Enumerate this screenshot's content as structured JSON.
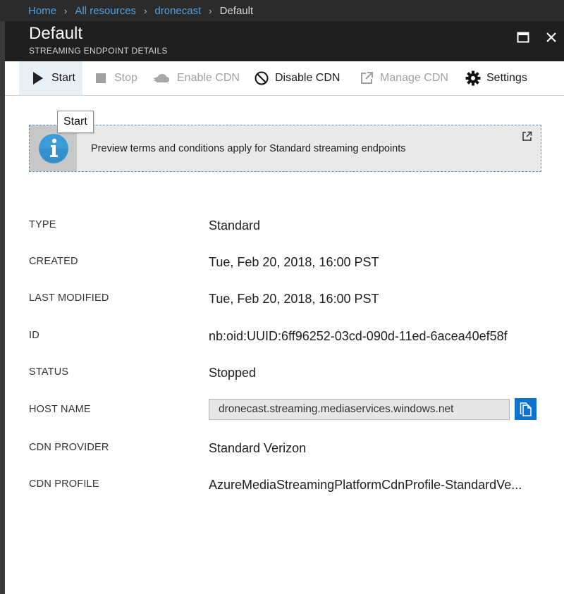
{
  "breadcrumb": {
    "items": [
      "Home",
      "All resources",
      "dronecast"
    ],
    "current": "Default",
    "separator": "›"
  },
  "header": {
    "title": "Default",
    "subtitle": "STREAMING ENDPOINT DETAILS"
  },
  "toolbar": {
    "start": "Start",
    "stop": "Stop",
    "enable_cdn": "Enable CDN",
    "disable_cdn": "Disable CDN",
    "manage_cdn": "Manage CDN",
    "settings": "Settings"
  },
  "tooltip": "Start",
  "info": {
    "text": "Preview terms and conditions apply for Standard streaming endpoints"
  },
  "props": {
    "type": {
      "label": "TYPE",
      "value": "Standard"
    },
    "created": {
      "label": "CREATED",
      "value": "Tue, Feb 20, 2018, 16:00 PST"
    },
    "modified": {
      "label": "LAST MODIFIED",
      "value": "Tue, Feb 20, 2018, 16:00 PST"
    },
    "id": {
      "label": "ID",
      "value": "nb:oid:UUID:6ff96252-03cd-090d-11ed-6acea40ef58f"
    },
    "status": {
      "label": "STATUS",
      "value": "Stopped"
    },
    "host": {
      "label": "HOST NAME",
      "value": "dronecast.streaming.mediaservices.windows.net"
    },
    "cdn_provider": {
      "label": "CDN PROVIDER",
      "value": "Standard Verizon"
    },
    "cdn_profile": {
      "label": "CDN PROFILE",
      "value": "AzureMediaStreamingPlatformCdnProfile-StandardVe..."
    }
  },
  "colors": {
    "accent": "#0f72cf",
    "link": "#4aa0e6",
    "header_bg": "#1f1f1f",
    "disabled": "#a0a0a0"
  },
  "icons": [
    "chevron-right-icon",
    "maximize-icon",
    "close-icon",
    "play-icon",
    "stop-icon",
    "cloud-cdn-icon",
    "ban-icon",
    "external-link-icon",
    "gear-icon",
    "info-icon",
    "copy-icon"
  ]
}
